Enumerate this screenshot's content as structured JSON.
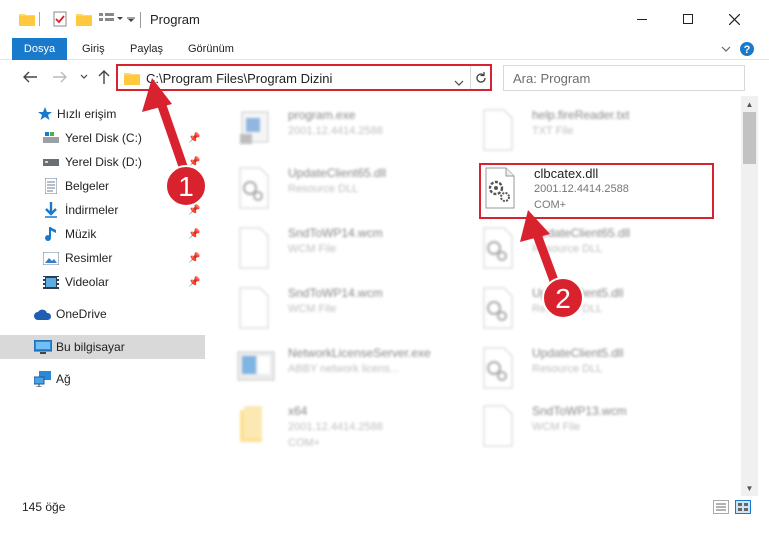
{
  "window": {
    "title": "Program",
    "minimize_icon": "minimize-icon",
    "maximize_icon": "maximize-icon",
    "close_icon": "close-icon"
  },
  "ribbon": {
    "tabs": [
      "Dosya",
      "Giriş",
      "Paylaş",
      "Görünüm"
    ]
  },
  "address": {
    "path": "C:\\Program Files\\Program Dizini",
    "search_placeholder": "Ara: Program"
  },
  "sidebar": {
    "items": [
      {
        "label": "Hızlı erişim",
        "icon": "star-icon"
      },
      {
        "label": "Yerel Disk (C:)",
        "icon": "drive-icon",
        "pinned": true
      },
      {
        "label": "Yerel Disk (D:)",
        "icon": "drive-icon",
        "pinned": true
      },
      {
        "label": "Belgeler",
        "icon": "documents-icon",
        "pinned": true
      },
      {
        "label": "İndirmeler",
        "icon": "download-icon",
        "pinned": true
      },
      {
        "label": "Müzik",
        "icon": "music-icon",
        "pinned": true
      },
      {
        "label": "Resimler",
        "icon": "pictures-icon",
        "pinned": true
      },
      {
        "label": "Videolar",
        "icon": "videos-icon",
        "pinned": true
      },
      {
        "label": "OneDrive",
        "icon": "cloud-icon"
      },
      {
        "label": "Bu bilgisayar",
        "icon": "computer-icon",
        "selected": true
      },
      {
        "label": "Ağ",
        "icon": "network-icon"
      }
    ]
  },
  "files": [
    {
      "name": "program.exe",
      "meta1": "2001.12.4414.2588",
      "meta2": "",
      "icon": "exe-icon"
    },
    {
      "name": "help.fireReader.txt",
      "meta1": "TXT File",
      "meta2": "",
      "icon": "txt-icon"
    },
    {
      "name": "UpdateClient65.dll",
      "meta1": "Resource DLL",
      "meta2": "",
      "icon": "dll-icon"
    },
    {
      "name": "clbcatex.dll",
      "meta1": "2001.12.4414.2588",
      "meta2": "COM+",
      "icon": "dll-gear-icon"
    },
    {
      "name": "SndToWP14.wcm",
      "meta1": "WCM File",
      "meta2": "",
      "icon": "file-icon"
    },
    {
      "name": "UpdateClient65.dll",
      "meta1": "Resource DLL",
      "meta2": "",
      "icon": "dll-icon"
    },
    {
      "name": "SndToWP14.wcm",
      "meta1": "WCM File",
      "meta2": "",
      "icon": "file-icon"
    },
    {
      "name": "UpdateClient5.dll",
      "meta1": "Resource DLL",
      "meta2": "",
      "icon": "dll-icon"
    },
    {
      "name": "NetworkLicenseServer.exe",
      "meta1": "ABBY network licens...",
      "meta2": "",
      "icon": "exe-icon"
    },
    {
      "name": "UpdateClient5.dll",
      "meta1": "Resource DLL",
      "meta2": "",
      "icon": "dll-icon"
    },
    {
      "name": "x64",
      "meta1": "2001.12.4414.2588",
      "meta2": "COM+",
      "icon": "folder-icon"
    },
    {
      "name": "SndToWP13.wcm",
      "meta1": "WCM File",
      "meta2": "",
      "icon": "file-icon"
    }
  ],
  "status": {
    "item_count": "145 öğe"
  },
  "annotations": {
    "marker1": "1",
    "marker2": "2",
    "color": "#d8232f"
  },
  "colors": {
    "accent": "#1979ca",
    "highlight": "#d8232f",
    "selected_bg": "#d9d9d9"
  }
}
